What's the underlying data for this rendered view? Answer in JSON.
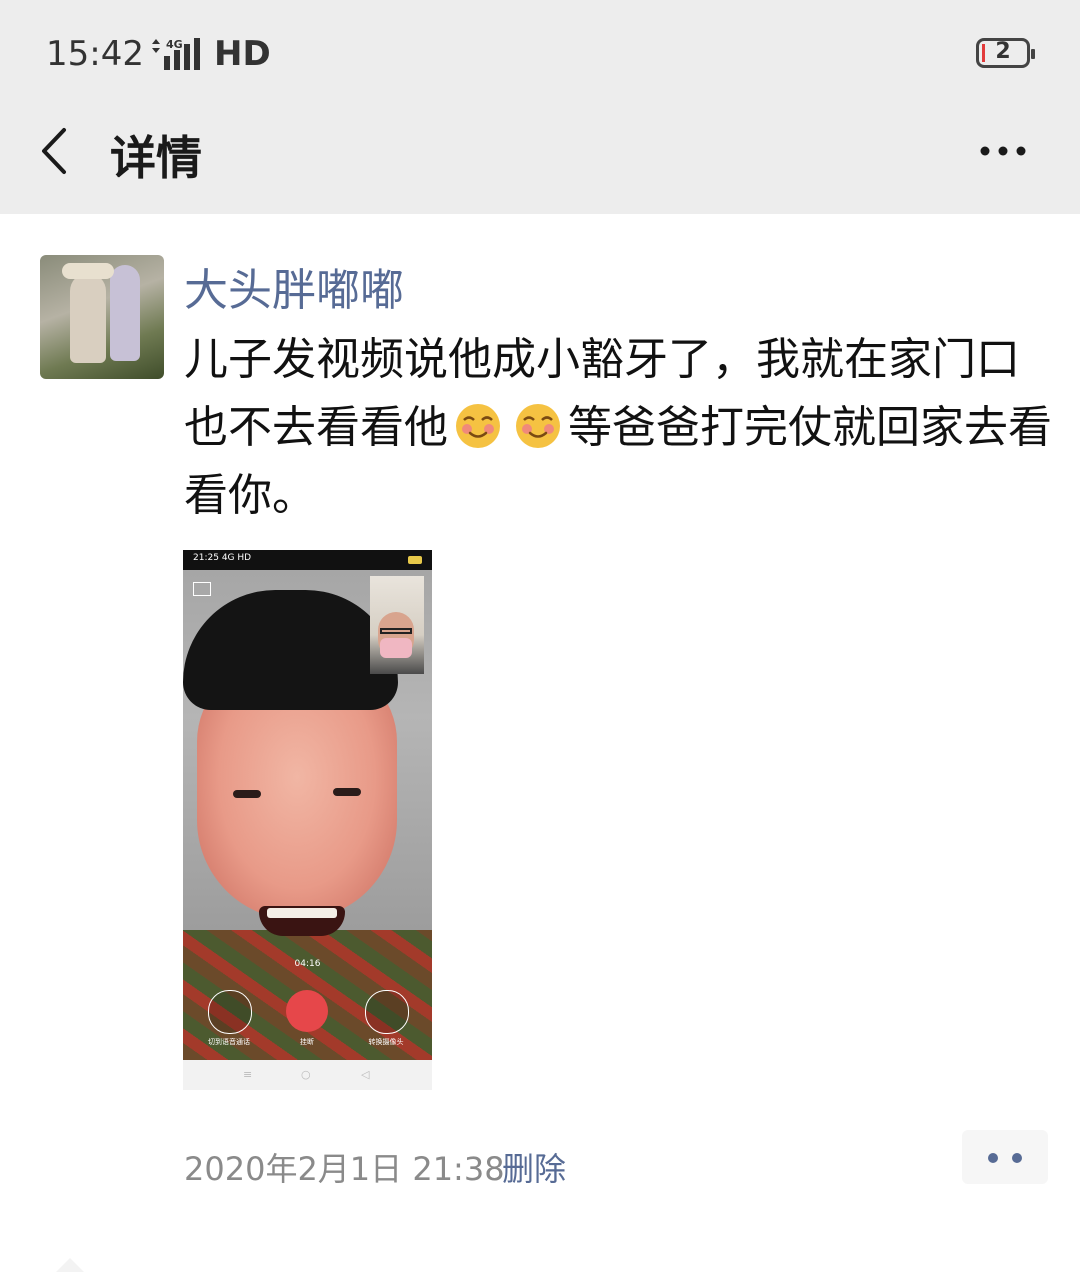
{
  "status_bar": {
    "time": "15:42",
    "network": "4G",
    "hd": "HD",
    "battery": "2",
    "battery_icon": "battery-icon",
    "signal_icon": "signal-icon"
  },
  "nav": {
    "back_icon": "chevron-left-icon",
    "title": "详情",
    "more_icon": "more-horizontal-icon"
  },
  "post": {
    "avatar_icon": "avatar",
    "user_name": "大头胖嘟嘟",
    "text_part1": "儿子发视频说他成小豁牙了，我就在家门口也不去看看他",
    "emoji_icon": "blushing-smile-emoji",
    "text_part2": "等爸爸打完仗就回家去看看你。",
    "image": {
      "status_time": "21:25",
      "status_network": "4G",
      "status_hd": "HD",
      "call_timer": "04:16",
      "btn_switch_label": "切到语音通话",
      "btn_hangup_label": "挂断",
      "btn_camera_label": "转换摄像头",
      "nav_menu": "≡",
      "nav_home": "○",
      "nav_back": "◁"
    },
    "timestamp": "2020年2月1日 21:38",
    "delete_label": "删除",
    "action_icon": "more-dots-icon"
  },
  "colors": {
    "header_bg": "#ededed",
    "name_link": "#576b95",
    "text": "#111111",
    "meta": "#8a8a8a"
  }
}
